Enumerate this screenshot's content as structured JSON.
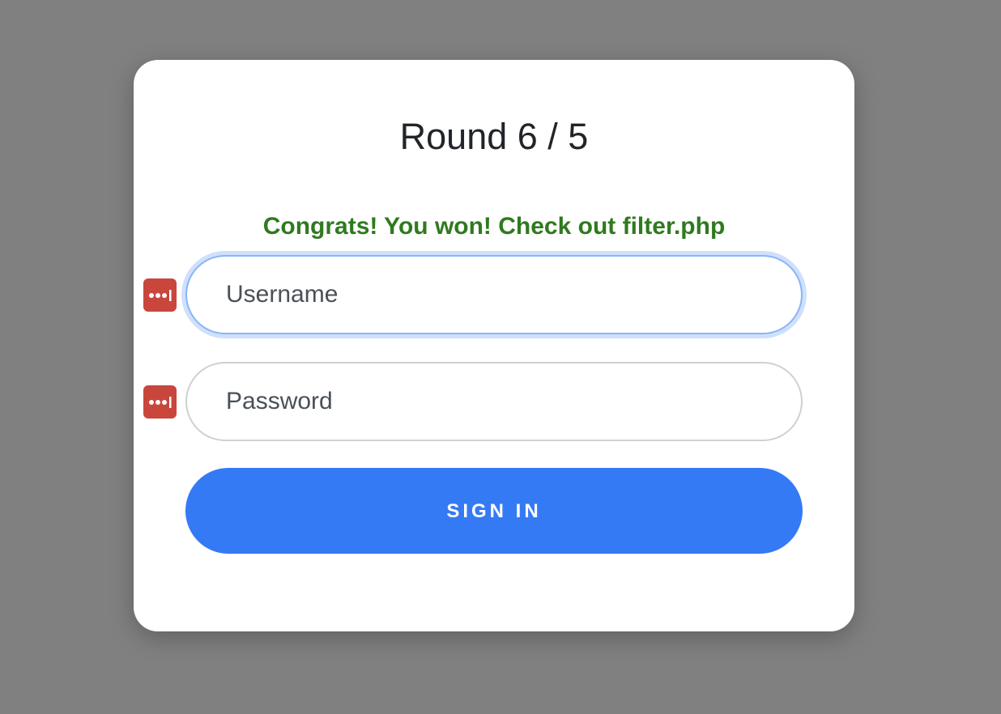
{
  "round": {
    "title": "Round 6 / 5"
  },
  "status": {
    "message": "Congrats! You won! Check out filter.php",
    "color": "#2f7a1f"
  },
  "form": {
    "username": {
      "placeholder": "Username",
      "value": ""
    },
    "password": {
      "placeholder": "Password",
      "value": ""
    },
    "submit_label": "SIGN IN"
  },
  "icons": {
    "password_manager": "password-manager-icon"
  },
  "colors": {
    "background": "#808080",
    "card": "#ffffff",
    "button": "#357af5",
    "pm_icon": "#c9463d"
  }
}
